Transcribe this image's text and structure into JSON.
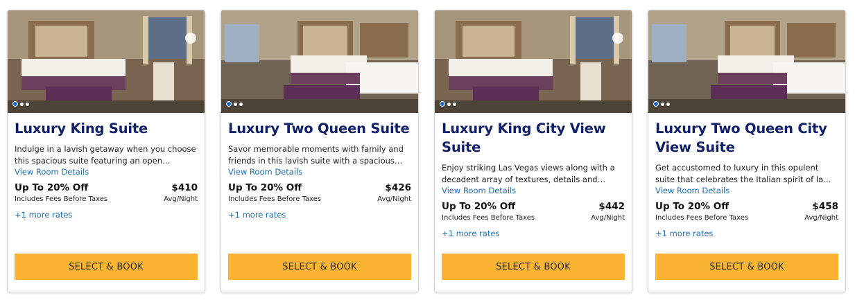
{
  "rooms": [
    {
      "title": "Luxury King Suite",
      "description": "Indulge in a lavish getaway when you choose this spacious suite featuring an open bedroom and a sunken living room area",
      "details_link": "View Room Details",
      "discount": "Up To 20% Off",
      "price": "$410",
      "fees_note": "Includes Fees Before Taxes",
      "per_unit": "Avg/Night",
      "more_rates": "+1 more rates",
      "cta": "SELECT & BOOK",
      "photo_icon": "hotel-room-photo"
    },
    {
      "title": "Luxury Two Queen Suite",
      "description": "Savor memorable moments with family and friends in this lavish suite with a spacious sunken living room area",
      "details_link": "View Room Details",
      "discount": "Up To 20% Off",
      "price": "$426",
      "fees_note": "Includes Fees Before Taxes",
      "per_unit": "Avg/Night",
      "more_rates": "+1 more rates",
      "cta": "SELECT & BOOK",
      "photo_icon": "hotel-room-photo"
    },
    {
      "title": "Luxury King City View Suite",
      "description": "Enjoy striking Las Vegas views along with a decadent array of textures, details and elegant furnishings",
      "details_link": "View Room Details",
      "discount": "Up To 20% Off",
      "price": "$442",
      "fees_note": "Includes Fees Before Taxes",
      "per_unit": "Avg/Night",
      "more_rates": "+1 more rates",
      "cta": "SELECT & BOOK",
      "photo_icon": "hotel-room-photo"
    },
    {
      "title": "Luxury Two Queen City View Suite",
      "description": "Get accustomed to luxury in this opulent suite that celebrates the Italian spirit of la dolce vita",
      "details_link": "View Room Details",
      "discount": "Up To 20% Off",
      "price": "$458",
      "fees_note": "Includes Fees Before Taxes",
      "per_unit": "Avg/Night",
      "more_rates": "+1 more rates",
      "cta": "SELECT & BOOK",
      "photo_icon": "hotel-room-photo"
    }
  ],
  "colors": {
    "title": "#0f2068",
    "link": "#1e6fb8",
    "button": "#fbb431",
    "active_dot": "#1e6fd0"
  }
}
